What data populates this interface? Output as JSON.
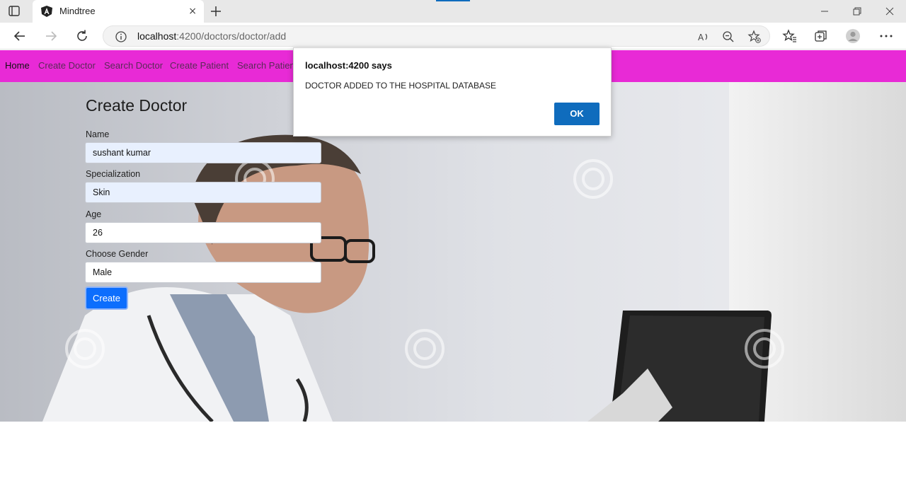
{
  "browser": {
    "tab_title": "Mindtree",
    "tab_close": "×",
    "url_host": "localhost",
    "url_path": ":4200/doctors/doctor/add"
  },
  "navbar": {
    "items": [
      {
        "label": "Home"
      },
      {
        "label": "Create Doctor"
      },
      {
        "label": "Search Doctor"
      },
      {
        "label": "Create Patient"
      },
      {
        "label": "Search Patient"
      }
    ]
  },
  "form": {
    "title": "Create Doctor",
    "name_label": "Name",
    "name_value": "sushant kumar",
    "specialization_label": "Specialization",
    "specialization_value": "Skin",
    "age_label": "Age",
    "age_value": "26",
    "gender_label": "Choose Gender",
    "gender_value": "Male",
    "create_label": "Create"
  },
  "dialog": {
    "title": "localhost:4200 says",
    "message": "DOCTOR ADDED TO THE HOSPITAL DATABASE",
    "ok_label": "OK"
  },
  "colors": {
    "navbar_bg": "#e82ad6",
    "primary_button": "#0d6efd",
    "dialog_button": "#0f6cbd"
  },
  "icons": {
    "tab_actions": "tab-actions-icon",
    "favicon": "angular-icon",
    "new_tab": "plus-icon",
    "back": "back-arrow-icon",
    "forward": "forward-arrow-icon",
    "refresh": "refresh-icon",
    "info": "info-icon",
    "read_aloud": "read-aloud-icon",
    "zoom_out": "zoom-out-icon",
    "add_favorite": "add-favorite-icon",
    "favorites": "favorites-icon",
    "collections": "collections-icon",
    "profile": "profile-icon",
    "menu": "more-menu-icon"
  }
}
